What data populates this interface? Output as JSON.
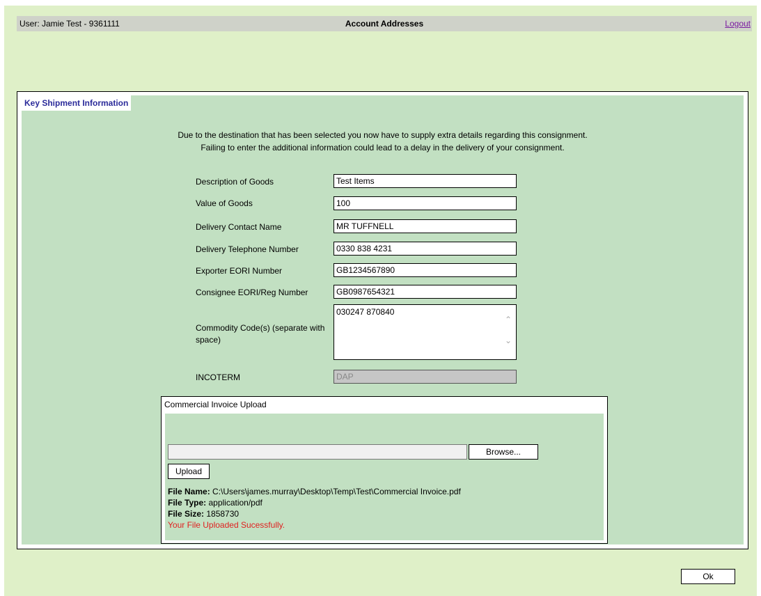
{
  "header": {
    "user": "User: Jamie Test - 9361111",
    "title": "Account Addresses",
    "logout": "Logout"
  },
  "section": {
    "title": "Key Shipment Information",
    "intro_line1": "Due to the destination that has been selected you now have to supply extra details regarding this consignment.",
    "intro_line2": "Failing to enter the additional information could lead to a delay in the delivery of your consignment."
  },
  "form": {
    "description_label": "Description of Goods",
    "description_value": "Test Items",
    "value_label": "Value of Goods",
    "value_value": "100",
    "contact_label": "Delivery Contact Name",
    "contact_value": "MR TUFFNELL",
    "phone_label": "Delivery Telephone Number",
    "phone_value": "0330 838 4231",
    "exporter_label": "Exporter EORI Number",
    "exporter_value": "GB1234567890",
    "consignee_label": "Consignee EORI/Reg Number",
    "consignee_value": "GB0987654321",
    "commodity_label": "Commodity Code(s) (separate with space)",
    "commodity_value": "030247 870840",
    "incoterm_label": "INCOTERM",
    "incoterm_value": "DAP"
  },
  "upload": {
    "caption": "Commercial Invoice Upload",
    "browse_label": "Browse...",
    "upload_label": "Upload",
    "file_name_label": "File Name:",
    "file_name": "C:\\Users\\james.murray\\Desktop\\Temp\\Test\\Commercial Invoice.pdf",
    "file_type_label": "File Type:",
    "file_type": "application/pdf",
    "file_size_label": "File Size:",
    "file_size": "1858730",
    "success_message": "Your File Uploaded Sucessfully."
  },
  "footer": {
    "ok_label": "Ok"
  },
  "colors": {
    "page_bg": "#dff0c8",
    "panel_bg": "#c2e0c2",
    "header_bg": "#cfd2c9",
    "section_title": "#2b2b9a",
    "success": "#e02020",
    "logout_link": "#7a1aa0"
  }
}
